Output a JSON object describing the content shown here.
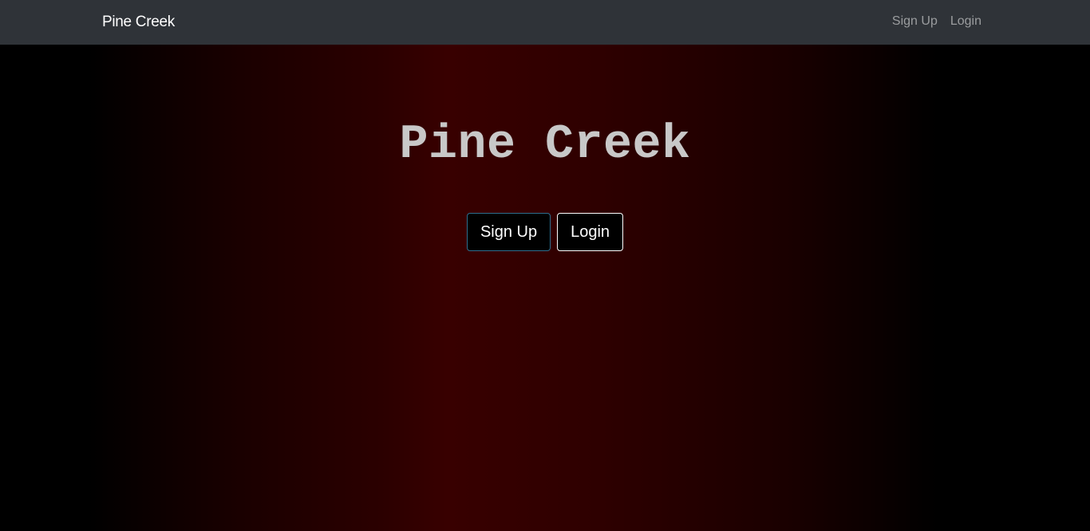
{
  "navbar": {
    "brand": "Pine Creek",
    "links": [
      {
        "label": "Sign Up"
      },
      {
        "label": "Login"
      }
    ]
  },
  "hero": {
    "title": "Pine Creek",
    "signup_label": "Sign Up",
    "login_label": "Login"
  },
  "colors": {
    "navbar_bg": "#2f3338",
    "accent_border": "#2f6f8f",
    "gradient_center": "#380000"
  }
}
